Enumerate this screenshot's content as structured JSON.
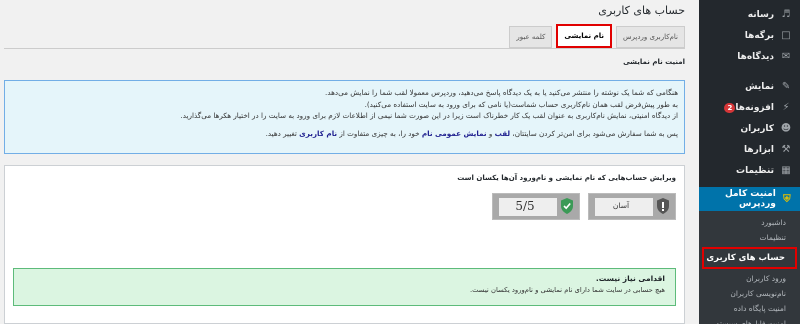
{
  "sidebar": {
    "items": [
      {
        "label": "رسانه",
        "icon": "media-icon"
      },
      {
        "label": "برگه‌ها",
        "icon": "pages-icon"
      },
      {
        "label": "دیدگاه‌ها",
        "icon": "comments-icon"
      },
      {
        "label": "نمایش",
        "icon": "appearance-icon"
      },
      {
        "label": "افزونه‌ها",
        "icon": "plugins-icon",
        "badge": "2"
      },
      {
        "label": "کاربران",
        "icon": "users-icon"
      },
      {
        "label": "ابزارها",
        "icon": "tools-icon"
      },
      {
        "label": "تنظیمات",
        "icon": "settings-icon"
      }
    ],
    "active": {
      "label": "امنیت کامل وردپرس",
      "icon": "shield-icon"
    },
    "sub": {
      "dashboard": "داشبورد",
      "settings": "تنظیمات",
      "current": "حساب های کاربری",
      "login": "ورود کاربران",
      "registration": "نام‌نویسی کاربران",
      "database": "امنیت پایگاه داده",
      "filesystem": "امنیت فایل‌های سیستم"
    }
  },
  "page": {
    "title": "حساب های کاربری",
    "tabs": {
      "wp_username": "نام‌کاربری وردپرس",
      "display_name": "نام نمایشی",
      "password": "کلمه عبور"
    },
    "section_label": "امنیت نام نمایشی"
  },
  "info": {
    "line1": "هنگامی که شما یک نوشته را منتشر می‌کنید یا به یک دیدگاه پاسخ می‌دهید، وردپرس معمولا لقب شما را نمایش می‌دهد.",
    "line2": "به طور پیش‌فرض لقب همان نام‌کاربری حساب شماست(یا نامی که برای ورود به سایت استفاده می‌کنید).",
    "line3": "از دیدگاه امنیتی، نمایش نام‌کاربری به عنوان لقب یک کار خطرناک است زیرا در این صورت شما نیمی از اطلاعات لازم برای ورود به سایت را در اختیار هکرها می‌گذارید.",
    "line4_a": "پس به شما سفارش می‌شود برای امن‌تر کردن سایتتان، ",
    "line4_b": "لقب",
    "line4_c": " و ",
    "line4_d": "نمایش عمومی نام",
    "line4_e": " خود را، به چیزی متفاوت از ",
    "line4_f": "نام کاربری",
    "line4_g": " تغییر دهید."
  },
  "panel": {
    "heading": "ویرایش حساب‌هایی که نام نمایشی و نام‌ورود آن‌ها یکسان است",
    "difficulty": "آسان",
    "score": "5/5",
    "success_title": "اقدامی نیاز نیست.",
    "success_text": "هیچ حسابی در سایت شما دارای نام نمایشی و نام‌ورود یکسان نیست."
  }
}
